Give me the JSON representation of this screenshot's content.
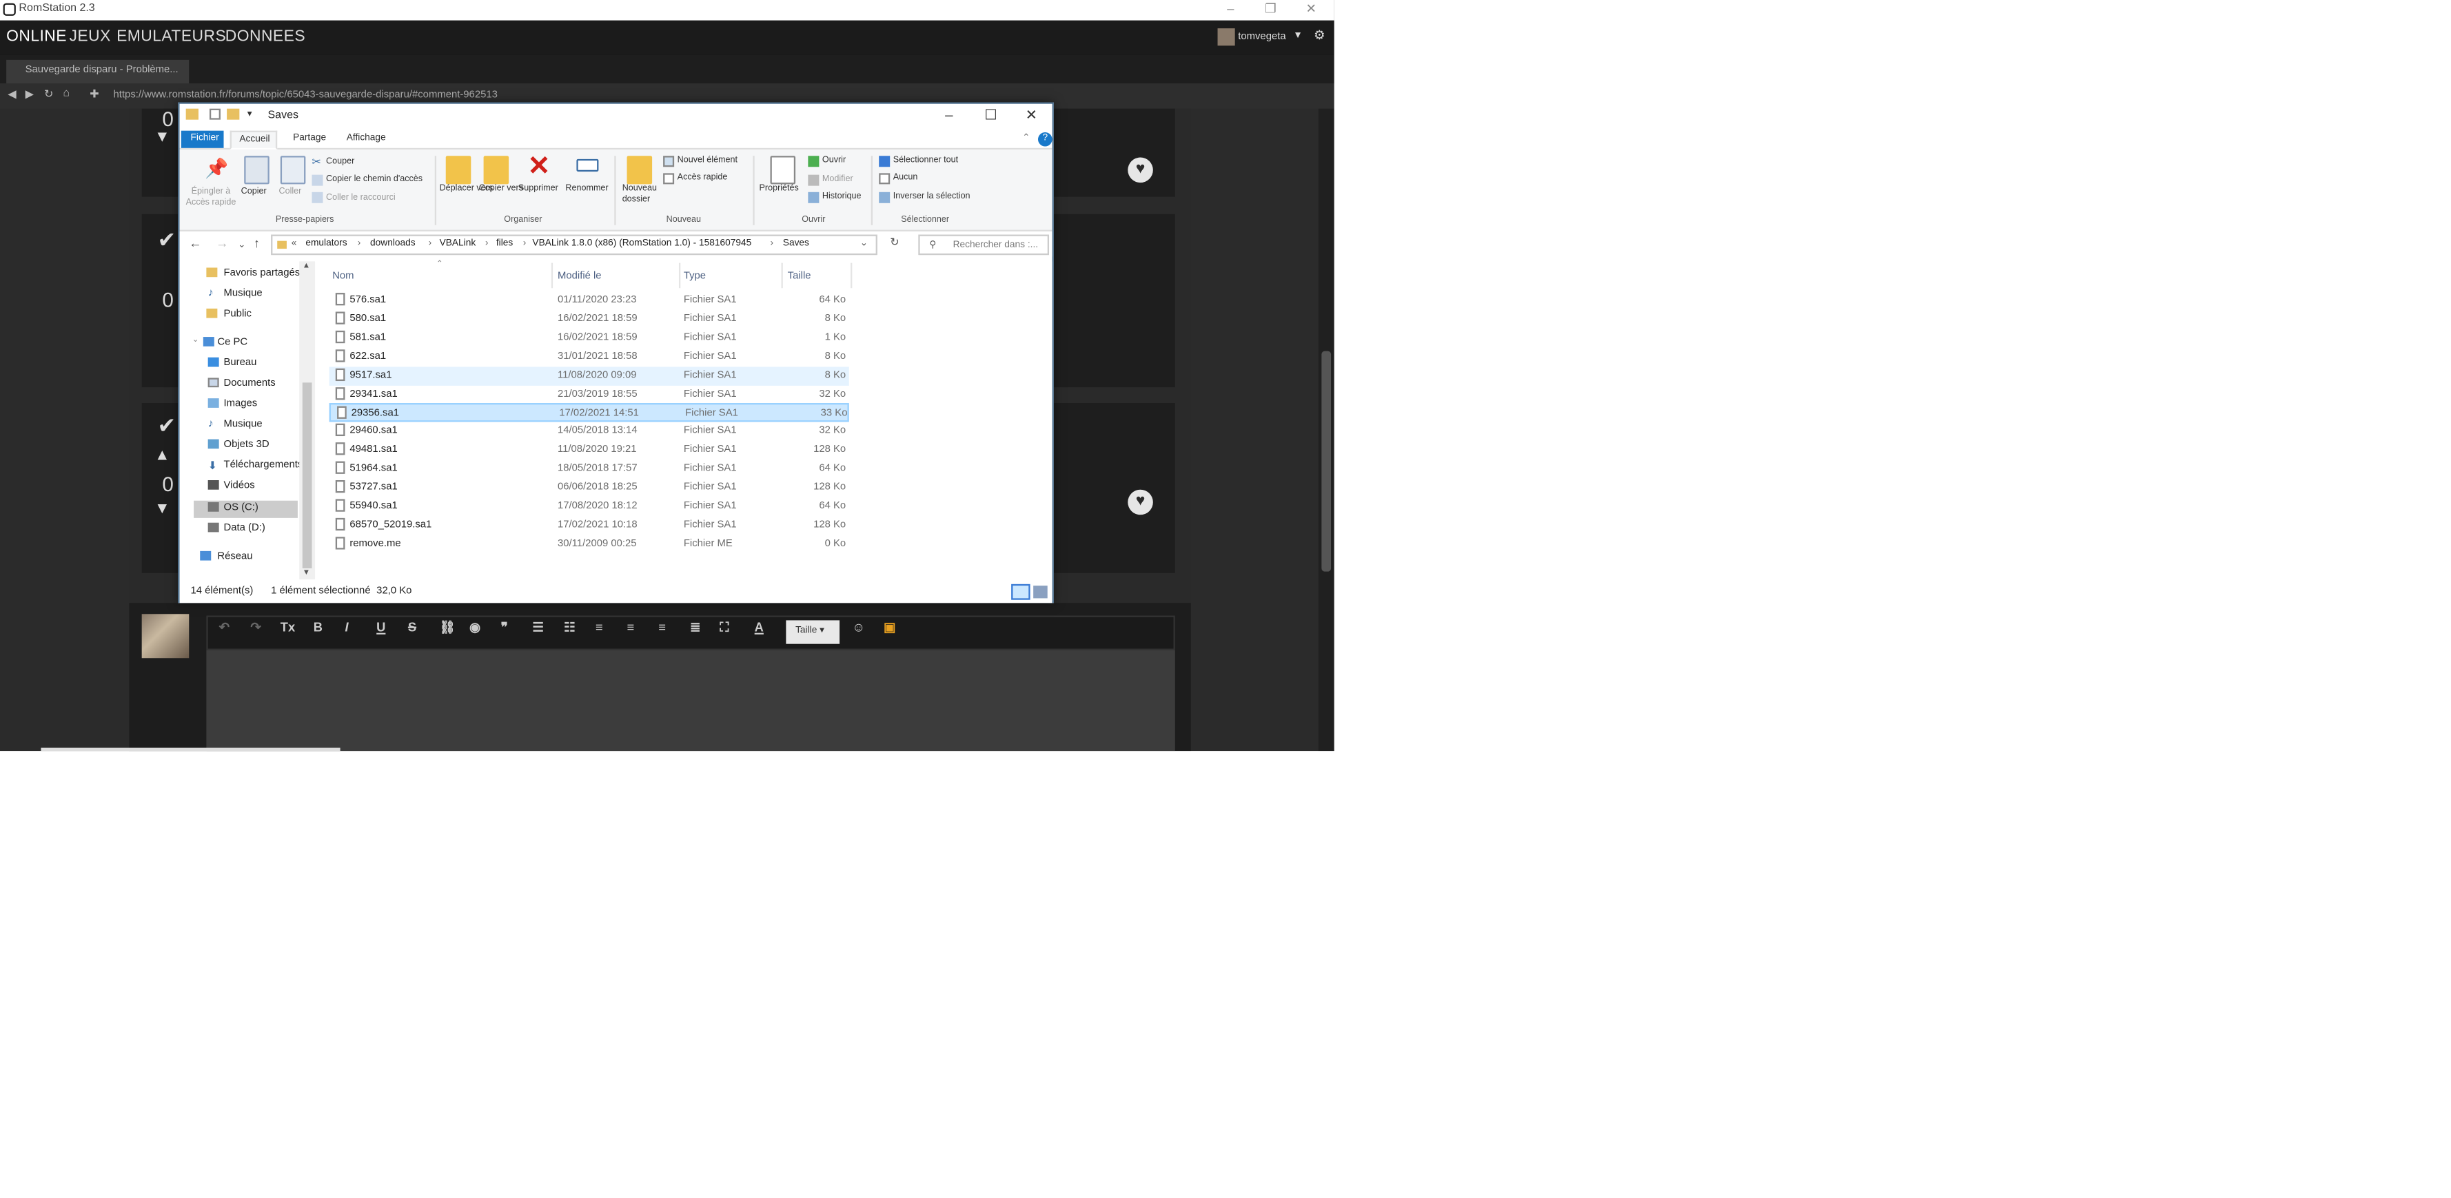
{
  "app": {
    "window_title": "RomStation 2.3",
    "nav": [
      "ONLINE",
      "JEUX",
      "EMULATEURS",
      "DONNEES"
    ],
    "user": "tomvegeta",
    "tab_title": "Sauvegarde disparu - Problème...",
    "url": "https://www.romstation.fr/forums/topic/65043-sauvegarde-disparu/#comment-962513",
    "vote_counts": [
      "0",
      "0",
      "0"
    ],
    "editor": {
      "size_label": "Taille"
    }
  },
  "explorer": {
    "title": "Saves",
    "ribbon_tabs": [
      "Fichier",
      "Accueil",
      "Partage",
      "Affichage"
    ],
    "clipboard": {
      "pin": "Épingler à\nAccès rapide",
      "copy": "Copier",
      "paste": "Coller",
      "cut": "Couper",
      "copy_path": "Copier le chemin d'accès",
      "paste_shortcut": "Coller le raccourci",
      "group": "Presse-papiers"
    },
    "organize": {
      "move": "Déplacer vers",
      "copy_to": "Copier vers",
      "delete": "Supprimer",
      "rename": "Renommer",
      "group": "Organiser"
    },
    "new": {
      "folder": "Nouveau dossier",
      "new_item": "Nouvel élément",
      "easy_access": "Accès rapide",
      "group": "Nouveau"
    },
    "open": {
      "properties": "Propriétés",
      "open": "Ouvrir",
      "edit": "Modifier",
      "history": "Historique",
      "group": "Ouvrir"
    },
    "select": {
      "all": "Sélectionner tout",
      "none": "Aucun",
      "invert": "Inverser la sélection",
      "group": "Sélectionner"
    },
    "breadcrumb": [
      "emulators",
      "downloads",
      "VBALink",
      "files",
      "VBALink 1.8.0 (x86) (RomStation 1.0) - 1581607945",
      "Saves"
    ],
    "search_placeholder": "Rechercher dans :...",
    "nav_pane": [
      "Favoris partagés",
      "Musique",
      "Public",
      "Ce PC",
      "Bureau",
      "Documents",
      "Images",
      "Musique",
      "Objets 3D",
      "Téléchargements",
      "Vidéos",
      "OS (C:)",
      "Data (D:)",
      "Réseau"
    ],
    "columns": [
      "Nom",
      "Modifié le",
      "Type",
      "Taille"
    ],
    "files": [
      {
        "name": "576.sa1",
        "date": "01/11/2020 23:23",
        "type": "Fichier SA1",
        "size": "64 Ko"
      },
      {
        "name": "580.sa1",
        "date": "16/02/2021 18:59",
        "type": "Fichier SA1",
        "size": "8 Ko"
      },
      {
        "name": "581.sa1",
        "date": "16/02/2021 18:59",
        "type": "Fichier SA1",
        "size": "1 Ko"
      },
      {
        "name": "622.sa1",
        "date": "31/01/2021 18:58",
        "type": "Fichier SA1",
        "size": "8 Ko"
      },
      {
        "name": "9517.sa1",
        "date": "11/08/2020 09:09",
        "type": "Fichier SA1",
        "size": "8 Ko"
      },
      {
        "name": "29341.sa1",
        "date": "21/03/2019 18:55",
        "type": "Fichier SA1",
        "size": "32 Ko"
      },
      {
        "name": "29356.sa1",
        "date": "17/02/2021 14:51",
        "type": "Fichier SA1",
        "size": "33 Ko"
      },
      {
        "name": "29460.sa1",
        "date": "14/05/2018 13:14",
        "type": "Fichier SA1",
        "size": "32 Ko"
      },
      {
        "name": "49481.sa1",
        "date": "11/08/2020 19:21",
        "type": "Fichier SA1",
        "size": "128 Ko"
      },
      {
        "name": "51964.sa1",
        "date": "18/05/2018 17:57",
        "type": "Fichier SA1",
        "size": "64 Ko"
      },
      {
        "name": "53727.sa1",
        "date": "06/06/2018 18:25",
        "type": "Fichier SA1",
        "size": "128 Ko"
      },
      {
        "name": "55940.sa1",
        "date": "17/08/2020 18:12",
        "type": "Fichier SA1",
        "size": "64 Ko"
      },
      {
        "name": "68570_52019.sa1",
        "date": "17/02/2021 10:18",
        "type": "Fichier SA1",
        "size": "128 Ko"
      },
      {
        "name": "remove.me",
        "date": "30/11/2009 00:25",
        "type": "Fichier ME",
        "size": "0 Ko"
      }
    ],
    "status": {
      "count": "14 élément(s)",
      "selected": "1 élément sélectionné",
      "selected_size": "32,0 Ko"
    }
  }
}
